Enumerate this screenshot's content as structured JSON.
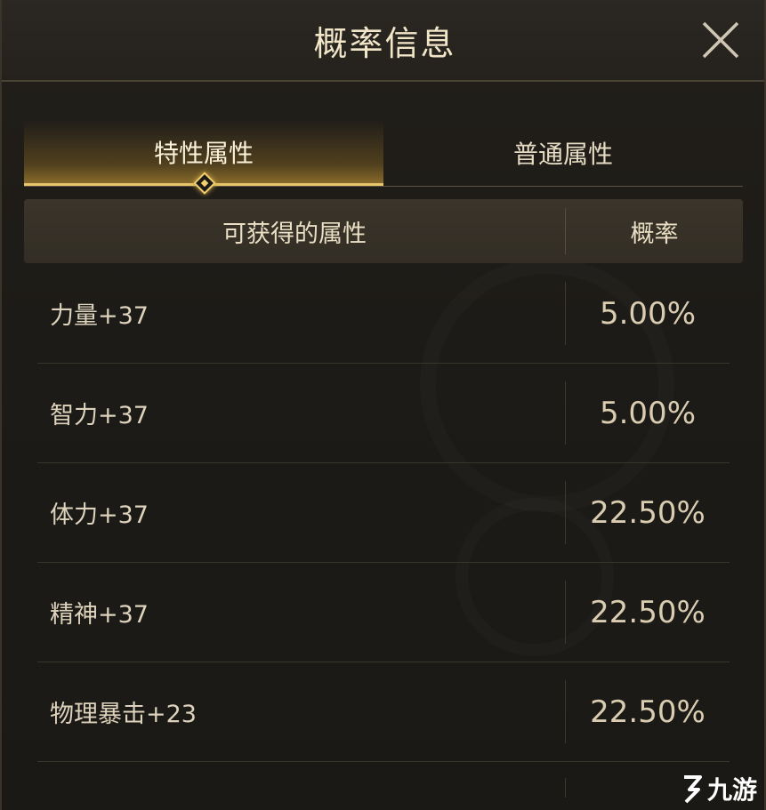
{
  "header": {
    "title": "概率信息",
    "close_icon": "close-icon"
  },
  "tabs": [
    {
      "label": "特性属性",
      "active": true
    },
    {
      "label": "普通属性",
      "active": false
    }
  ],
  "table": {
    "headers": {
      "attribute": "可获得的属性",
      "probability": "概率"
    },
    "rows": [
      {
        "attribute": "力量+37",
        "probability": "5.00%"
      },
      {
        "attribute": "智力+37",
        "probability": "5.00%"
      },
      {
        "attribute": "体力+37",
        "probability": "22.50%"
      },
      {
        "attribute": "精神+37",
        "probability": "22.50%"
      },
      {
        "attribute": "物理暴击+23",
        "probability": "22.50%"
      }
    ]
  },
  "watermark": {
    "text": "九游"
  },
  "colors": {
    "accent": "#e8c46a",
    "title": "#f2e6c8",
    "background": "#1c1a17"
  }
}
